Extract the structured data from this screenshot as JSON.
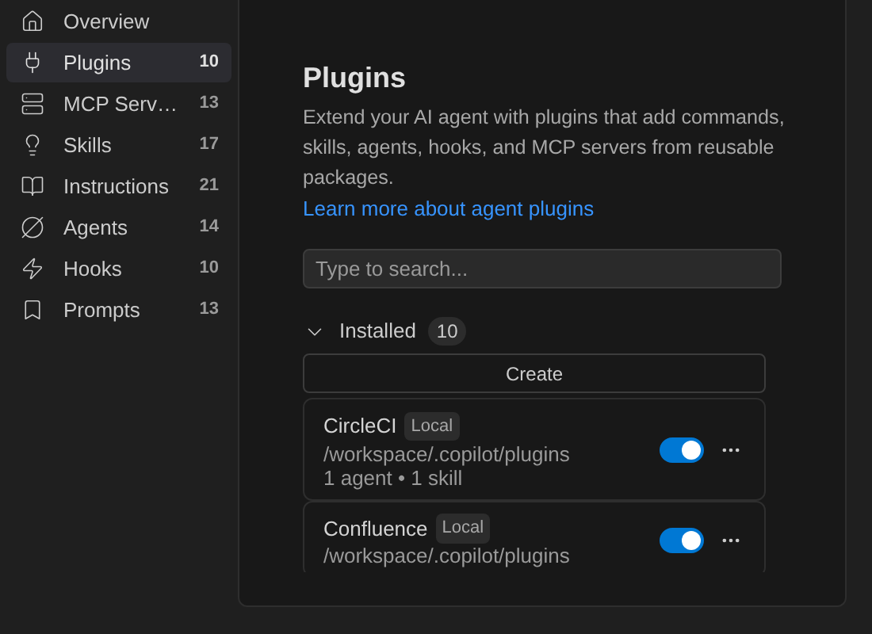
{
  "sidebar": {
    "items": [
      {
        "label": "Overview",
        "selected": false
      },
      {
        "label": "Plugins",
        "count": "10",
        "selected": true
      },
      {
        "label": "MCP Serv…",
        "count": "13",
        "selected": false
      },
      {
        "label": "Skills",
        "count": "17",
        "selected": false
      },
      {
        "label": "Instructions",
        "count": "21",
        "selected": false
      },
      {
        "label": "Agents",
        "count": "14",
        "selected": false
      },
      {
        "label": "Hooks",
        "count": "10",
        "selected": false
      },
      {
        "label": "Prompts",
        "count": "13",
        "selected": false
      }
    ]
  },
  "main": {
    "title": "Plugins",
    "description": "Extend your AI agent with plugins that add commands, skills, agents, hooks, and MCP servers from reusable packages.",
    "link": "Learn more about agent plugins",
    "search": {
      "placeholder": "Type to search..."
    },
    "section": {
      "label": "Installed",
      "count": "10",
      "expanded": true
    },
    "create_button": "Create",
    "plugins": [
      {
        "name": "CircleCI",
        "badge": "Local",
        "path": "/workspace/.copilot/plugins",
        "summary": "1 agent • 1 skill",
        "on": true
      },
      {
        "name": "Confluence",
        "badge": "Local",
        "path": "/workspace/.copilot/plugins",
        "on": true
      }
    ]
  }
}
